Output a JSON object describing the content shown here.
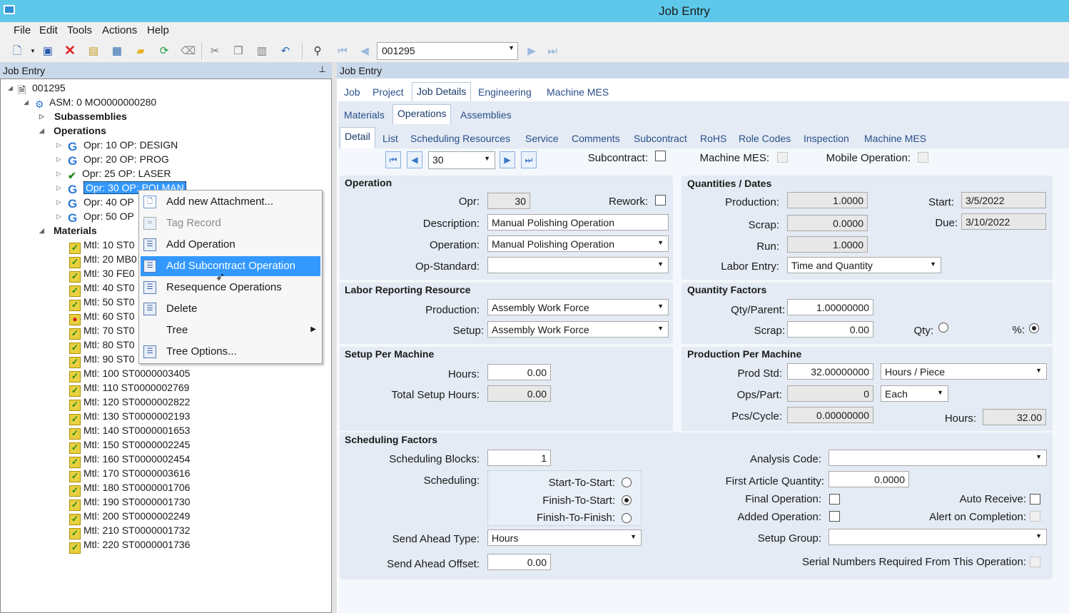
{
  "window": {
    "title": "Job Entry"
  },
  "menu": [
    "File",
    "Edit",
    "Tools",
    "Actions",
    "Help"
  ],
  "toolbar": {
    "job_combo": "001295"
  },
  "left_panel": {
    "title": "Job Entry"
  },
  "right_panel": {
    "title": "Job Entry"
  },
  "tree": {
    "root": "001295",
    "asm": "ASM: 0 MO0000000280",
    "subassemblies": "Subassemblies",
    "operations": "Operations",
    "ops": [
      "Opr: 10 OP: DESIGN",
      "Opr: 20 OP: PROG",
      "Opr: 25 OP: LASER",
      "Opr: 30 OP: POLMAN",
      "Opr: 40 OP",
      "Opr: 50 OP"
    ],
    "materials": "Materials",
    "mtls": [
      "Mtl: 10 ST0",
      "Mtl: 20 MB0",
      "Mtl: 30 FE0",
      "Mtl: 40 ST0",
      "Mtl: 50 ST0",
      "Mtl: 60 ST0",
      "Mtl: 70 ST0",
      "Mtl: 80 ST0",
      "Mtl: 90 ST0",
      "Mtl: 100 ST0000003405",
      "Mtl: 110 ST0000002769",
      "Mtl: 120 ST0000002822",
      "Mtl: 130 ST0000002193",
      "Mtl: 140 ST0000001653",
      "Mtl: 150 ST0000002245",
      "Mtl: 160 ST0000002454",
      "Mtl: 170 ST0000003616",
      "Mtl: 180 ST0000001706",
      "Mtl: 190 ST0000001730",
      "Mtl: 200 ST0000002249",
      "Mtl: 210 ST0000001732",
      "Mtl: 220 ST0000001736"
    ]
  },
  "context_menu": [
    "Add new Attachment...",
    "Tag Record",
    "Add Operation",
    "Add Subcontract Operation",
    "Resequence Operations",
    "Delete",
    "Tree",
    "Tree Options..."
  ],
  "tabs1": [
    "Job",
    "Project",
    "Job Details",
    "Engineering",
    "Machine MES"
  ],
  "tabs2": [
    "Materials",
    "Operations",
    "Assemblies"
  ],
  "tabs3": [
    "Detail",
    "List",
    "Scheduling Resources",
    "Service",
    "Comments",
    "Subcontract",
    "RoHS",
    "Role Codes",
    "Inspection",
    "Machine MES"
  ],
  "nav": {
    "value": "30",
    "subcontract": "Subcontract:",
    "machine_mes": "Machine MES:",
    "mobile": "Mobile Operation:"
  },
  "operation": {
    "title": "Operation",
    "opr_lbl": "Opr:",
    "opr": "30",
    "rework_lbl": "Rework:",
    "desc_lbl": "Description:",
    "desc": "Manual Polishing Operation",
    "op_lbl": "Operation:",
    "op": "Manual Polishing Operation",
    "std_lbl": "Op-Standard:"
  },
  "qty_dates": {
    "title": "Quantities / Dates",
    "prod_lbl": "Production:",
    "prod": "1.0000",
    "scrap_lbl": "Scrap:",
    "scrap": "0.0000",
    "run_lbl": "Run:",
    "run": "1.0000",
    "start_lbl": "Start:",
    "start": "3/5/2022",
    "due_lbl": "Due:",
    "due": "3/10/2022",
    "labor_lbl": "Labor Entry:",
    "labor": "Time and Quantity"
  },
  "labor_res": {
    "title": "Labor Reporting Resource",
    "prod_lbl": "Production:",
    "prod": "Assembly Work Force",
    "setup_lbl": "Setup:",
    "setup": "Assembly Work Force"
  },
  "qty_factors": {
    "title": "Quantity Factors",
    "qp_lbl": "Qty/Parent:",
    "qp": "1.00000000",
    "scrap_lbl": "Scrap:",
    "scrap": "0.00",
    "qty_lbl": "Qty:",
    "pct_lbl": "%:"
  },
  "setup_machine": {
    "title": "Setup Per Machine",
    "hours_lbl": "Hours:",
    "hours": "0.00",
    "total_lbl": "Total Setup Hours:",
    "total": "0.00"
  },
  "prod_machine": {
    "title": "Production Per Machine",
    "std_lbl": "Prod Std:",
    "std": "32.00000000",
    "std_unit": "Hours / Piece",
    "ops_lbl": "Ops/Part:",
    "ops": "0",
    "ops_unit": "Each",
    "pcs_lbl": "Pcs/Cycle:",
    "pcs": "0.00000000",
    "hours_lbl": "Hours:",
    "hours": "32.00"
  },
  "sched": {
    "title": "Scheduling Factors",
    "blocks_lbl": "Scheduling Blocks:",
    "blocks": "1",
    "sched_lbl": "Scheduling:",
    "sts": "Start-To-Start:",
    "fts": "Finish-To-Start:",
    "ftf": "Finish-To-Finish:",
    "sat_lbl": "Send Ahead Type:",
    "sat": "Hours",
    "sao_lbl": "Send Ahead Offset:",
    "sao": "0.00",
    "analysis_lbl": "Analysis Code:",
    "faq_lbl": "First Article Quantity:",
    "faq": "0.0000",
    "final_lbl": "Final Operation:",
    "auto_lbl": "Auto Receive:",
    "added_lbl": "Added Operation:",
    "alert_lbl": "Alert on Completion:",
    "setupgrp_lbl": "Setup Group:",
    "serial_lbl": "Serial Numbers Required From This Operation:"
  }
}
